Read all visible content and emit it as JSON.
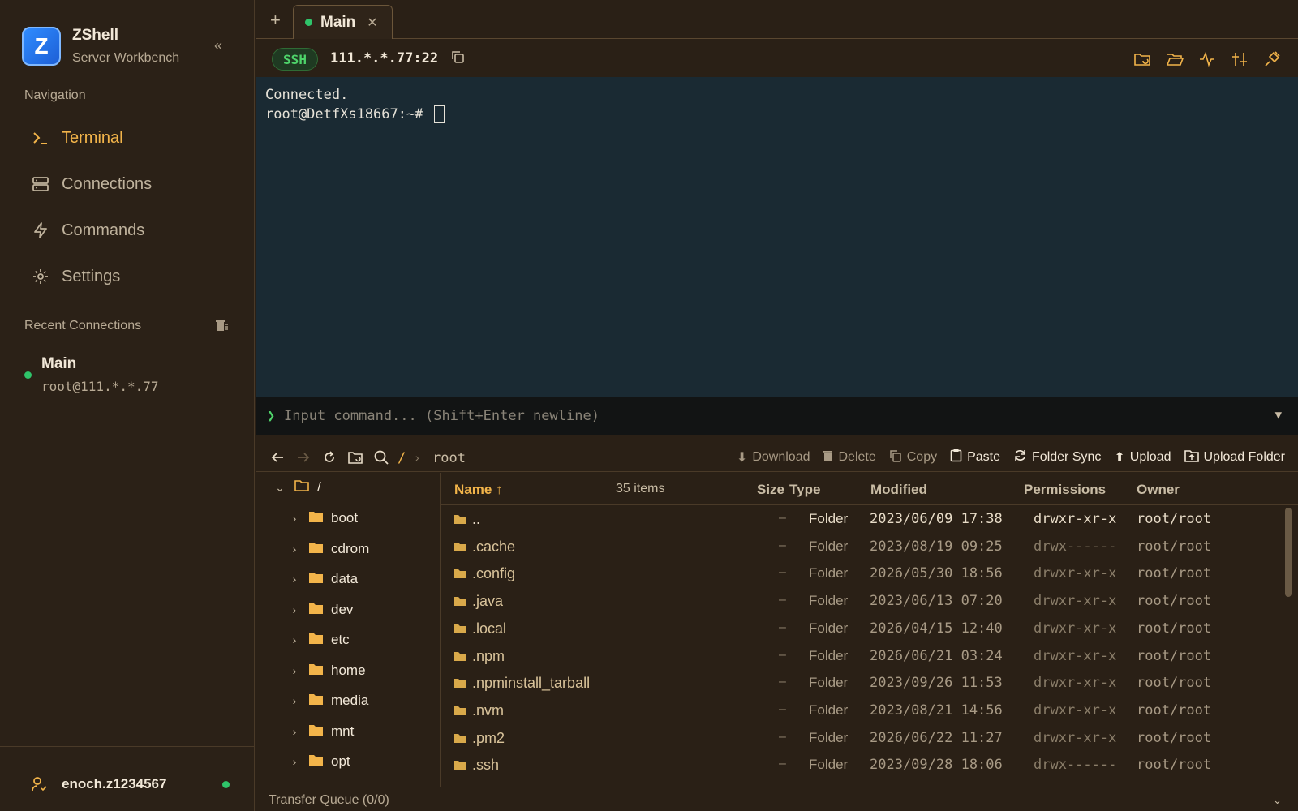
{
  "app": {
    "title": "ZShell",
    "subtitle": "Server Workbench",
    "logo_letter": "Z"
  },
  "sidebar": {
    "navigation_label": "Navigation",
    "items": [
      {
        "label": "Terminal",
        "icon": "terminal-icon",
        "active": true
      },
      {
        "label": "Connections",
        "icon": "server-icon",
        "active": false
      },
      {
        "label": "Commands",
        "icon": "lightning-icon",
        "active": false
      },
      {
        "label": "Settings",
        "icon": "gear-icon",
        "active": false
      }
    ],
    "recent_label": "Recent Connections",
    "recent": [
      {
        "name": "Main",
        "host": "root@111.*.*.77",
        "online": true
      }
    ],
    "user": {
      "name": "enoch.z1234567",
      "online": true
    }
  },
  "tabs": [
    {
      "label": "Main",
      "online": true
    }
  ],
  "connection": {
    "protocol": "SSH",
    "host": "111.*.*.77:22"
  },
  "terminal": {
    "lines": [
      "Connected.",
      "root@DetfXs18667:~# "
    ]
  },
  "command": {
    "placeholder": "Input command... (Shift+Enter newline)"
  },
  "file_manager": {
    "breadcrumb": {
      "root": "/",
      "current": "root"
    },
    "actions": [
      {
        "label": "Download",
        "icon": "download-icon",
        "enabled": false
      },
      {
        "label": "Delete",
        "icon": "trash-icon",
        "enabled": false
      },
      {
        "label": "Copy",
        "icon": "copy-icon",
        "enabled": false
      },
      {
        "label": "Paste",
        "icon": "clipboard-icon",
        "enabled": true
      },
      {
        "label": "Folder Sync",
        "icon": "sync-icon",
        "enabled": true
      },
      {
        "label": "Upload",
        "icon": "upload-icon",
        "enabled": true
      },
      {
        "label": "Upload Folder",
        "icon": "upload-folder-icon",
        "enabled": true
      }
    ],
    "tree": {
      "root": "/",
      "children": [
        "boot",
        "cdrom",
        "data",
        "dev",
        "etc",
        "home",
        "media",
        "mnt",
        "opt"
      ]
    },
    "columns": {
      "name": "Name ↑",
      "count": "35 items",
      "size": "Size",
      "type": "Type",
      "modified": "Modified",
      "permissions": "Permissions",
      "owner": "Owner"
    },
    "files": [
      {
        "name": "..",
        "size": "–",
        "type": "Folder",
        "modified": "2023/06/09 17:38",
        "permissions": "drwxr-xr-x",
        "owner": "root/root"
      },
      {
        "name": ".cache",
        "size": "–",
        "type": "Folder",
        "modified": "2023/08/19 09:25",
        "permissions": "drwx------",
        "owner": "root/root"
      },
      {
        "name": ".config",
        "size": "–",
        "type": "Folder",
        "modified": "2026/05/30 18:56",
        "permissions": "drwxr-xr-x",
        "owner": "root/root"
      },
      {
        "name": ".java",
        "size": "–",
        "type": "Folder",
        "modified": "2023/06/13 07:20",
        "permissions": "drwxr-xr-x",
        "owner": "root/root"
      },
      {
        "name": ".local",
        "size": "–",
        "type": "Folder",
        "modified": "2026/04/15 12:40",
        "permissions": "drwxr-xr-x",
        "owner": "root/root"
      },
      {
        "name": ".npm",
        "size": "–",
        "type": "Folder",
        "modified": "2026/06/21 03:24",
        "permissions": "drwxr-xr-x",
        "owner": "root/root"
      },
      {
        "name": ".npminstall_tarball",
        "size": "–",
        "type": "Folder",
        "modified": "2023/09/26 11:53",
        "permissions": "drwxr-xr-x",
        "owner": "root/root"
      },
      {
        "name": ".nvm",
        "size": "–",
        "type": "Folder",
        "modified": "2023/08/21 14:56",
        "permissions": "drwxr-xr-x",
        "owner": "root/root"
      },
      {
        "name": ".pm2",
        "size": "–",
        "type": "Folder",
        "modified": "2026/06/22 11:27",
        "permissions": "drwxr-xr-x",
        "owner": "root/root"
      },
      {
        "name": ".ssh",
        "size": "–",
        "type": "Folder",
        "modified": "2023/09/28 18:06",
        "permissions": "drwx------",
        "owner": "root/root"
      }
    ],
    "transfer_queue": "Transfer Queue (0/0)"
  },
  "colors": {
    "accent": "#f2b44a",
    "online": "#2fc46a",
    "terminal_bg": "#1a2a33",
    "sidebar_bg": "#2b2117"
  }
}
